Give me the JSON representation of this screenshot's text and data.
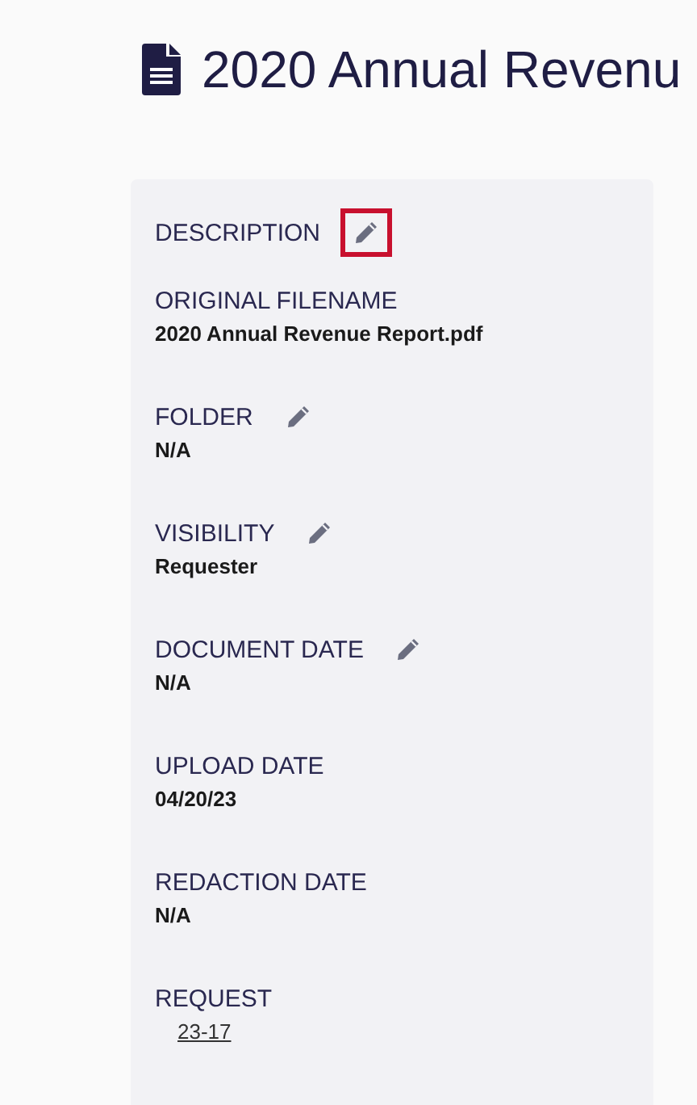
{
  "title": "2020 Annual Revenu",
  "fields": [
    {
      "label": "DESCRIPTION",
      "editable": true,
      "highlighted": true
    },
    {
      "label": "ORIGINAL FILENAME",
      "value": "2020 Annual Revenue Report.pdf",
      "kind": "text",
      "editable": false
    },
    {
      "label": "FOLDER",
      "value": "N/A",
      "kind": "text",
      "editable": true,
      "highlighted": false
    },
    {
      "label": "VISIBILITY",
      "value": "Requester",
      "kind": "text",
      "editable": true,
      "highlighted": false
    },
    {
      "label": "DOCUMENT DATE",
      "value": "N/A",
      "kind": "text",
      "editable": true,
      "highlighted": false
    },
    {
      "label": "UPLOAD DATE",
      "value": "04/20/23",
      "kind": "text",
      "editable": false
    },
    {
      "label": "REDACTION DATE",
      "value": "N/A",
      "kind": "text",
      "editable": false
    },
    {
      "label": "REQUEST",
      "value": "23-17",
      "kind": "link",
      "editable": false
    }
  ]
}
